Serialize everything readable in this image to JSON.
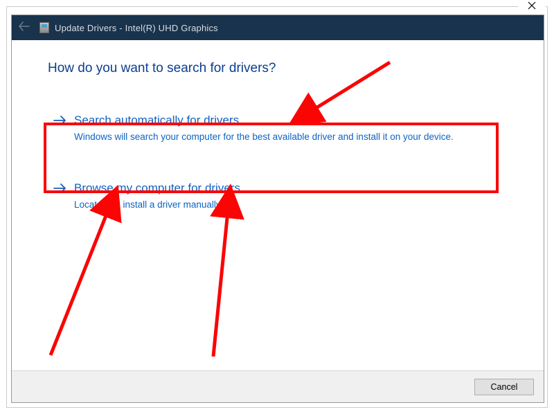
{
  "titlebar": {
    "title": "Update Drivers - Intel(R) UHD Graphics"
  },
  "content": {
    "heading": "How do you want to search for drivers?",
    "options": [
      {
        "title": "Search automatically for drivers",
        "desc": "Windows will search your computer for the best available driver and install it on your device."
      },
      {
        "title": "Browse my computer for drivers",
        "desc": "Locate and install a driver manually."
      }
    ]
  },
  "buttons": {
    "cancel": "Cancel"
  }
}
